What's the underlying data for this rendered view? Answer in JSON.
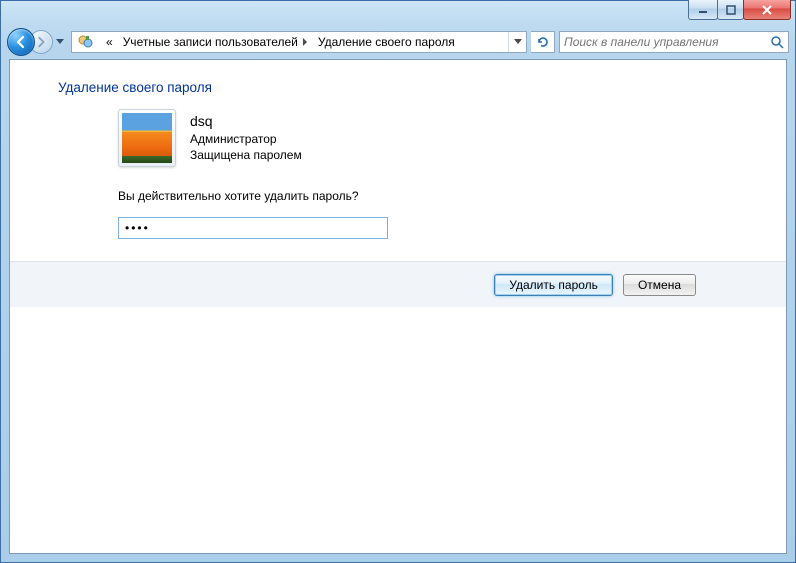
{
  "breadcrumbs": {
    "prefix": "«",
    "seg1": "Учетные записи пользователей",
    "seg2": "Удаление своего пароля"
  },
  "search": {
    "placeholder": "Поиск в панели управления"
  },
  "page": {
    "heading": "Удаление своего пароля",
    "user": {
      "name": "dsq",
      "role": "Администратор",
      "status": "Защищена паролем"
    },
    "question": "Вы действительно хотите удалить пароль?",
    "password_value": "••••"
  },
  "buttons": {
    "primary": "Удалить пароль",
    "cancel": "Отмена"
  }
}
